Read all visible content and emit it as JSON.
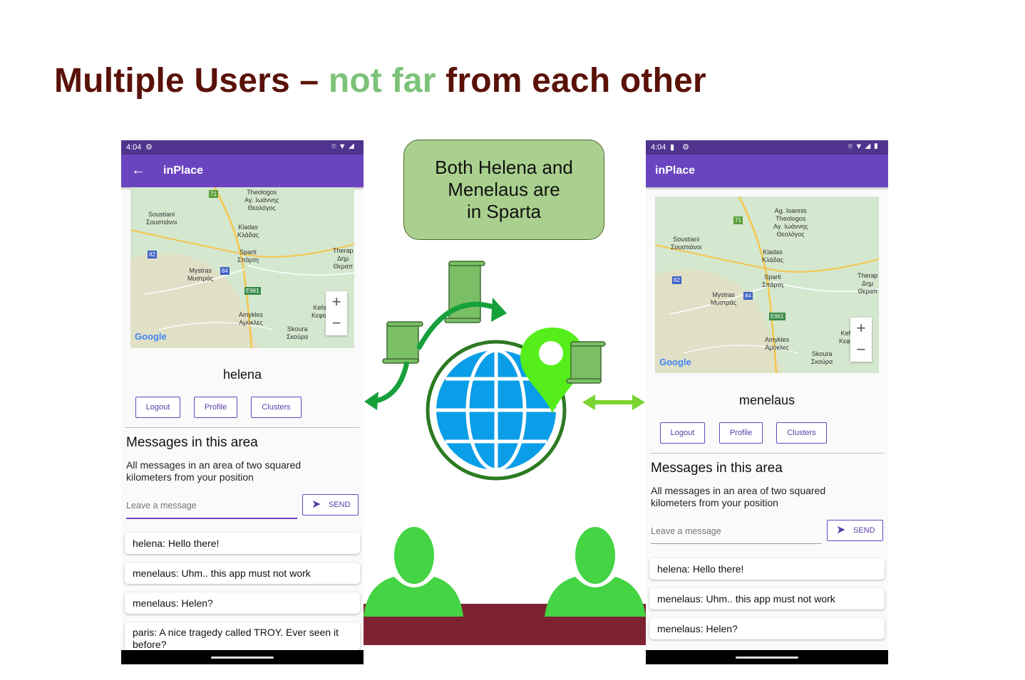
{
  "slide": {
    "title_part1": "Multiple Users – ",
    "title_highlight": "not far",
    "title_part2": " from each other",
    "callout": [
      "Both Helena and",
      "Menelaus are",
      "in Sparta"
    ]
  },
  "colors": {
    "title": "#5a1108",
    "highlight": "#7cc278",
    "app_bar": "#6b45bf",
    "status_bar": "#4f338f",
    "callout_bg": "#a9d08e",
    "globe_blue": "#0a9ee8",
    "person_green": "#44d444",
    "table": "#7e2233"
  },
  "map_labels": {
    "soustiani": [
      "Soustiani",
      "Σουστιάνοι"
    ],
    "theologos": [
      "Theologos",
      "Αγ. Ιωάννης",
      "Θεολόγος"
    ],
    "theologos_r": [
      "Ag. Ioannis",
      "Theologos",
      "Αγ. Ιωάννης",
      "Θεολόγος"
    ],
    "kladas": [
      "Kladas",
      "Κλάδας"
    ],
    "sparti": [
      "Sparti",
      "Σπάρτη"
    ],
    "mystras": [
      "Mystras",
      "Μυστράς"
    ],
    "therap": [
      "Therap",
      "Δημ",
      "Θεραπ"
    ],
    "amykles": [
      "Amykles",
      "Αμύκλες"
    ],
    "skoura": [
      "Skoura",
      "Σκούρα"
    ],
    "kefalas": [
      "Kefalas",
      "Κεφαλάς"
    ],
    "road_71": "71",
    "road_82": "82",
    "road_84": "84",
    "road_e961": "E961",
    "google": "Google"
  },
  "phone_left": {
    "time": "4:04",
    "app_title": "inPlace",
    "username": "helena",
    "buttons": {
      "logout": "Logout",
      "profile": "Profile",
      "clusters": "Clusters"
    },
    "messages_heading": "Messages in this area",
    "messages_desc": "All messages in an area of two squared kilometers from your position",
    "input_placeholder": "Leave a message",
    "send_label": "SEND",
    "messages": [
      "helena: Hello there!",
      "menelaus: Uhm.. this app must not work",
      "menelaus: Helen?",
      "paris: A nice tragedy called TROY. Ever seen it before?"
    ]
  },
  "phone_right": {
    "time": "4:04",
    "app_title": "inPlace",
    "username": "menelaus",
    "buttons": {
      "logout": "Logout",
      "profile": "Profile",
      "clusters": "Clusters"
    },
    "messages_heading": "Messages in this area",
    "messages_desc": "All messages in an area of two squared kilometers from your position",
    "input_placeholder": "Leave a message",
    "send_label": "SEND",
    "messages": [
      "helena: Hello there!",
      "menelaus: Uhm.. this app must not work",
      "menelaus: Helen?"
    ]
  }
}
